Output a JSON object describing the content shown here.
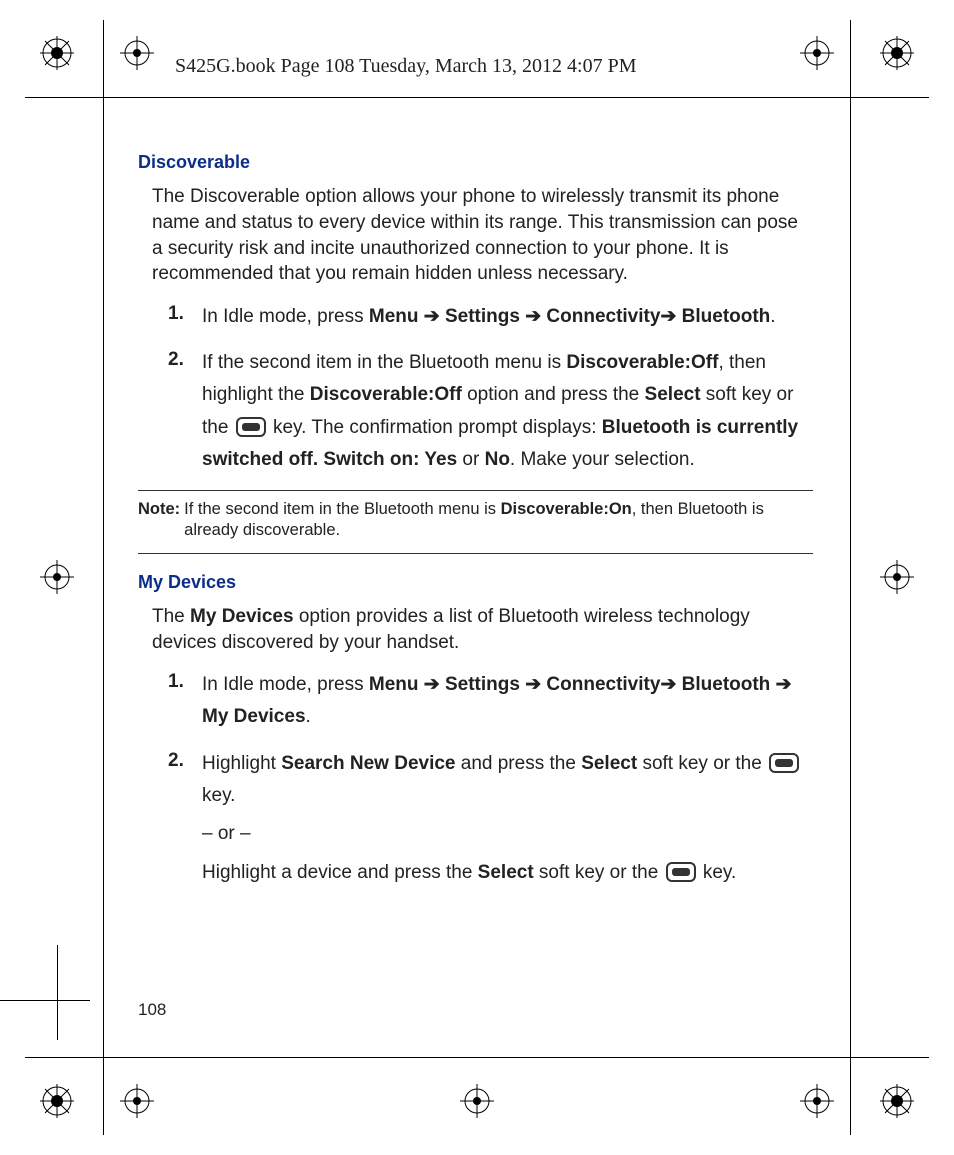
{
  "header": "S425G.book  Page 108  Tuesday, March 13, 2012  4:07 PM",
  "page_number": "108",
  "s1": {
    "title": "Discoverable",
    "intro": "The Discoverable option allows your phone to wirelessly transmit its phone name and status to every device within its range. This transmission can pose a security risk and incite unauthorized connection to your phone. It is recommended that you remain hidden unless necessary.",
    "step1_num": "1.",
    "step1_a": "In Idle mode, press ",
    "step1_b_menu": "Menu",
    "step1_arrow": " ➔ ",
    "step1_b_settings": "Settings",
    "step1_b_conn": "Connectivity",
    "step1_arrow2": "➔ ",
    "step1_b_bt": "Bluetooth",
    "step1_end": ".",
    "step2_num": "2.",
    "step2_a": "If the second item in the Bluetooth menu is ",
    "step2_b_discoff": "Discoverable:Off",
    "step2_c": ", then highlight the ",
    "step2_d_discoff2": "Discoverable:Off",
    "step2_e": " option and press the ",
    "step2_f_select": "Select",
    "step2_g": " soft key or the ",
    "step2_h": " key. The confirmation prompt displays: ",
    "step2_i_prompt": "Bluetooth is currently switched off. Switch on: Yes",
    "step2_j": " or ",
    "step2_k_no": "No",
    "step2_l": ". Make your selection."
  },
  "note": {
    "label": "Note:",
    "a": " If the second item in the Bluetooth menu is ",
    "b": "Discoverable:On",
    "c": ", then Bluetooth is already discoverable."
  },
  "s2": {
    "title": "My Devices",
    "intro_a": "The ",
    "intro_b": "My Devices",
    "intro_c": " option provides a list of Bluetooth wireless technology devices discovered by your handset.",
    "step1_num": "1.",
    "step1_a": "In Idle mode, press ",
    "step1_menu": "Menu",
    "step1_arrow": " ➔ ",
    "step1_settings": "Settings",
    "step1_conn": "Connectivity",
    "step1_arrow2": "➔ ",
    "step1_bt": "Bluetooth",
    "step1_myd": "My Devices",
    "step1_end": ".",
    "step2_num": "2.",
    "step2_a": "Highlight ",
    "step2_b": "Search New Device",
    "step2_c": " and press the ",
    "step2_d": "Select",
    "step2_e": " soft key or the ",
    "step2_f": " key.",
    "step2_or": "– or –",
    "step2_g": "Highlight a device and press the ",
    "step2_h": "Select",
    "step2_i": " soft key or the ",
    "step2_j": " key."
  }
}
